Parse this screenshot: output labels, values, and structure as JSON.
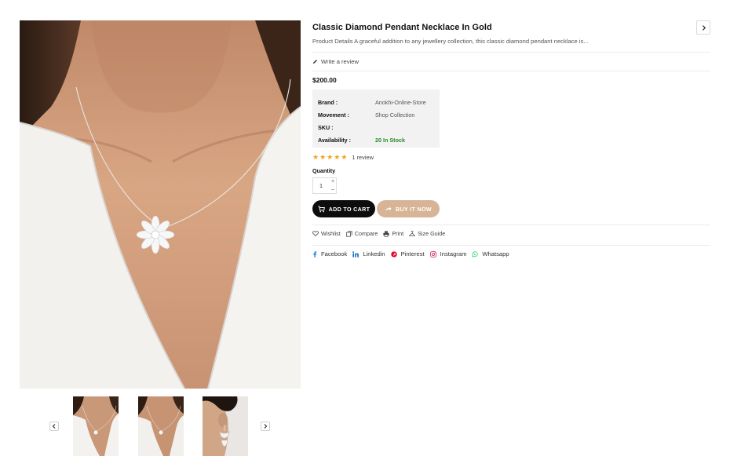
{
  "gallery": {
    "main_image_alt": "",
    "thumbnails": [
      "",
      "",
      ""
    ]
  },
  "product": {
    "title": "Classic Diamond Pendant Necklace In Gold",
    "description": "Product Details A graceful addition to any jewellery collection, this classic diamond pendant necklace is...",
    "write_review": "Write a review",
    "price": "$200.00",
    "info": [
      {
        "key": "Brand :",
        "value": "Anokhi-Online-Store"
      },
      {
        "key": "Movement :",
        "value": "Shop Collection"
      },
      {
        "key": "SKU :",
        "value": ""
      },
      {
        "key": "Availability :",
        "value": "20 In Stock"
      }
    ],
    "rating": {
      "stars": 5,
      "max": 5,
      "count_label": "1 review"
    },
    "quantity": {
      "label": "Quantity",
      "value": "1",
      "up": "+",
      "down": "–"
    }
  },
  "buttons": {
    "add_to_cart": "ADD TO CART",
    "buy_now": "BUY IT NOW"
  },
  "actions": {
    "wishlist": "Wishlist",
    "compare": "Compare",
    "print": "Print",
    "size_guide": "Size Guide"
  },
  "social": {
    "facebook": "Facebook",
    "linkedin": "Linkedin",
    "pinterest": "Pinterest",
    "instagram": "Instagram",
    "whatsapp": "Whatsapp"
  },
  "icons": {
    "nav_prev": "chevron-left-icon",
    "nav_next": "chevron-right-icon",
    "star": "star-icon"
  },
  "colors": {
    "accent_buy": "#d8b496",
    "cart_button": "#0d0d0d",
    "stock": "#2a8a2a",
    "star": "#f0a318",
    "facebook": "#1877f2",
    "linkedin": "#0a66c2",
    "pinterest": "#e60023",
    "instagram": "#d6336c",
    "whatsapp": "#25d366"
  }
}
